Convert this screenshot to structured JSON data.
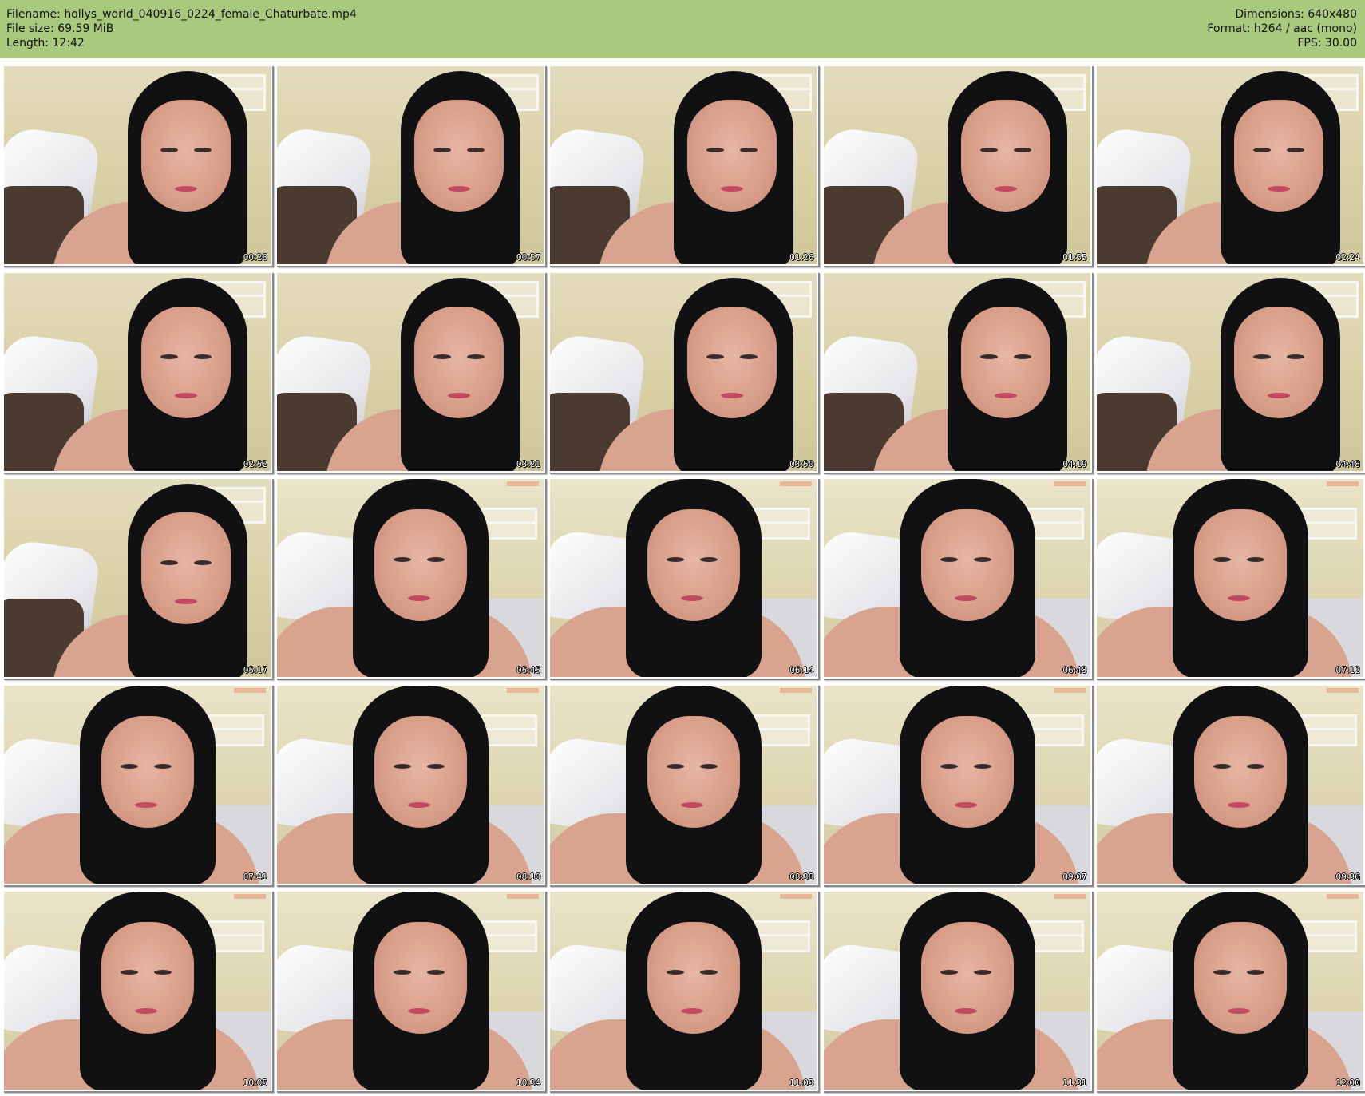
{
  "header": {
    "filename_label": "Filename:",
    "filename": "hollys_world_040916_0224_female_Chaturbate.mp4",
    "filesize_label": "File size:",
    "filesize": "69.59 MiB",
    "length_label": "Length:",
    "length": "12:42",
    "dimensions_label": "Dimensions:",
    "dimensions": "640x480",
    "format_label": "Format:",
    "format": "h264 / aac (mono)",
    "fps_label": "FPS:",
    "fps": "30.00"
  },
  "colors": {
    "header_bg": "#a9c97f",
    "page_bg": "#ffffff"
  },
  "thumbnails": [
    {
      "timestamp": "00:28"
    },
    {
      "timestamp": "00:57"
    },
    {
      "timestamp": "01:26"
    },
    {
      "timestamp": "01:55"
    },
    {
      "timestamp": "02:24"
    },
    {
      "timestamp": "02:52"
    },
    {
      "timestamp": "03:21"
    },
    {
      "timestamp": "03:50"
    },
    {
      "timestamp": "04:19"
    },
    {
      "timestamp": "04:48"
    },
    {
      "timestamp": "05:17"
    },
    {
      "timestamp": "05:45"
    },
    {
      "timestamp": "06:14"
    },
    {
      "timestamp": "06:43"
    },
    {
      "timestamp": "07:12"
    },
    {
      "timestamp": "07:41"
    },
    {
      "timestamp": "08:10"
    },
    {
      "timestamp": "08:38"
    },
    {
      "timestamp": "09:07"
    },
    {
      "timestamp": "09:36"
    },
    {
      "timestamp": "10:05"
    },
    {
      "timestamp": "10:34"
    },
    {
      "timestamp": "11:03"
    },
    {
      "timestamp": "11:31"
    },
    {
      "timestamp": "12:00"
    }
  ]
}
